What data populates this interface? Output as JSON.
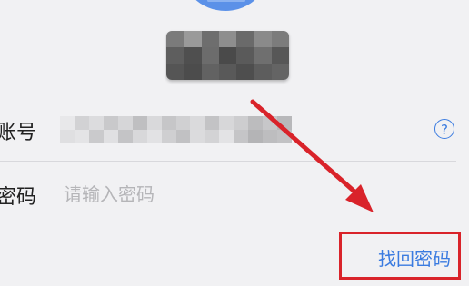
{
  "form": {
    "account_label": "账号",
    "password_label": "密码",
    "password_placeholder": "请输入密码",
    "help_icon": "?"
  },
  "links": {
    "forgot_password": "找回密码"
  },
  "colors": {
    "accent": "#3a7be0",
    "annotation": "#d9232a",
    "avatar": "#5b91e8"
  }
}
